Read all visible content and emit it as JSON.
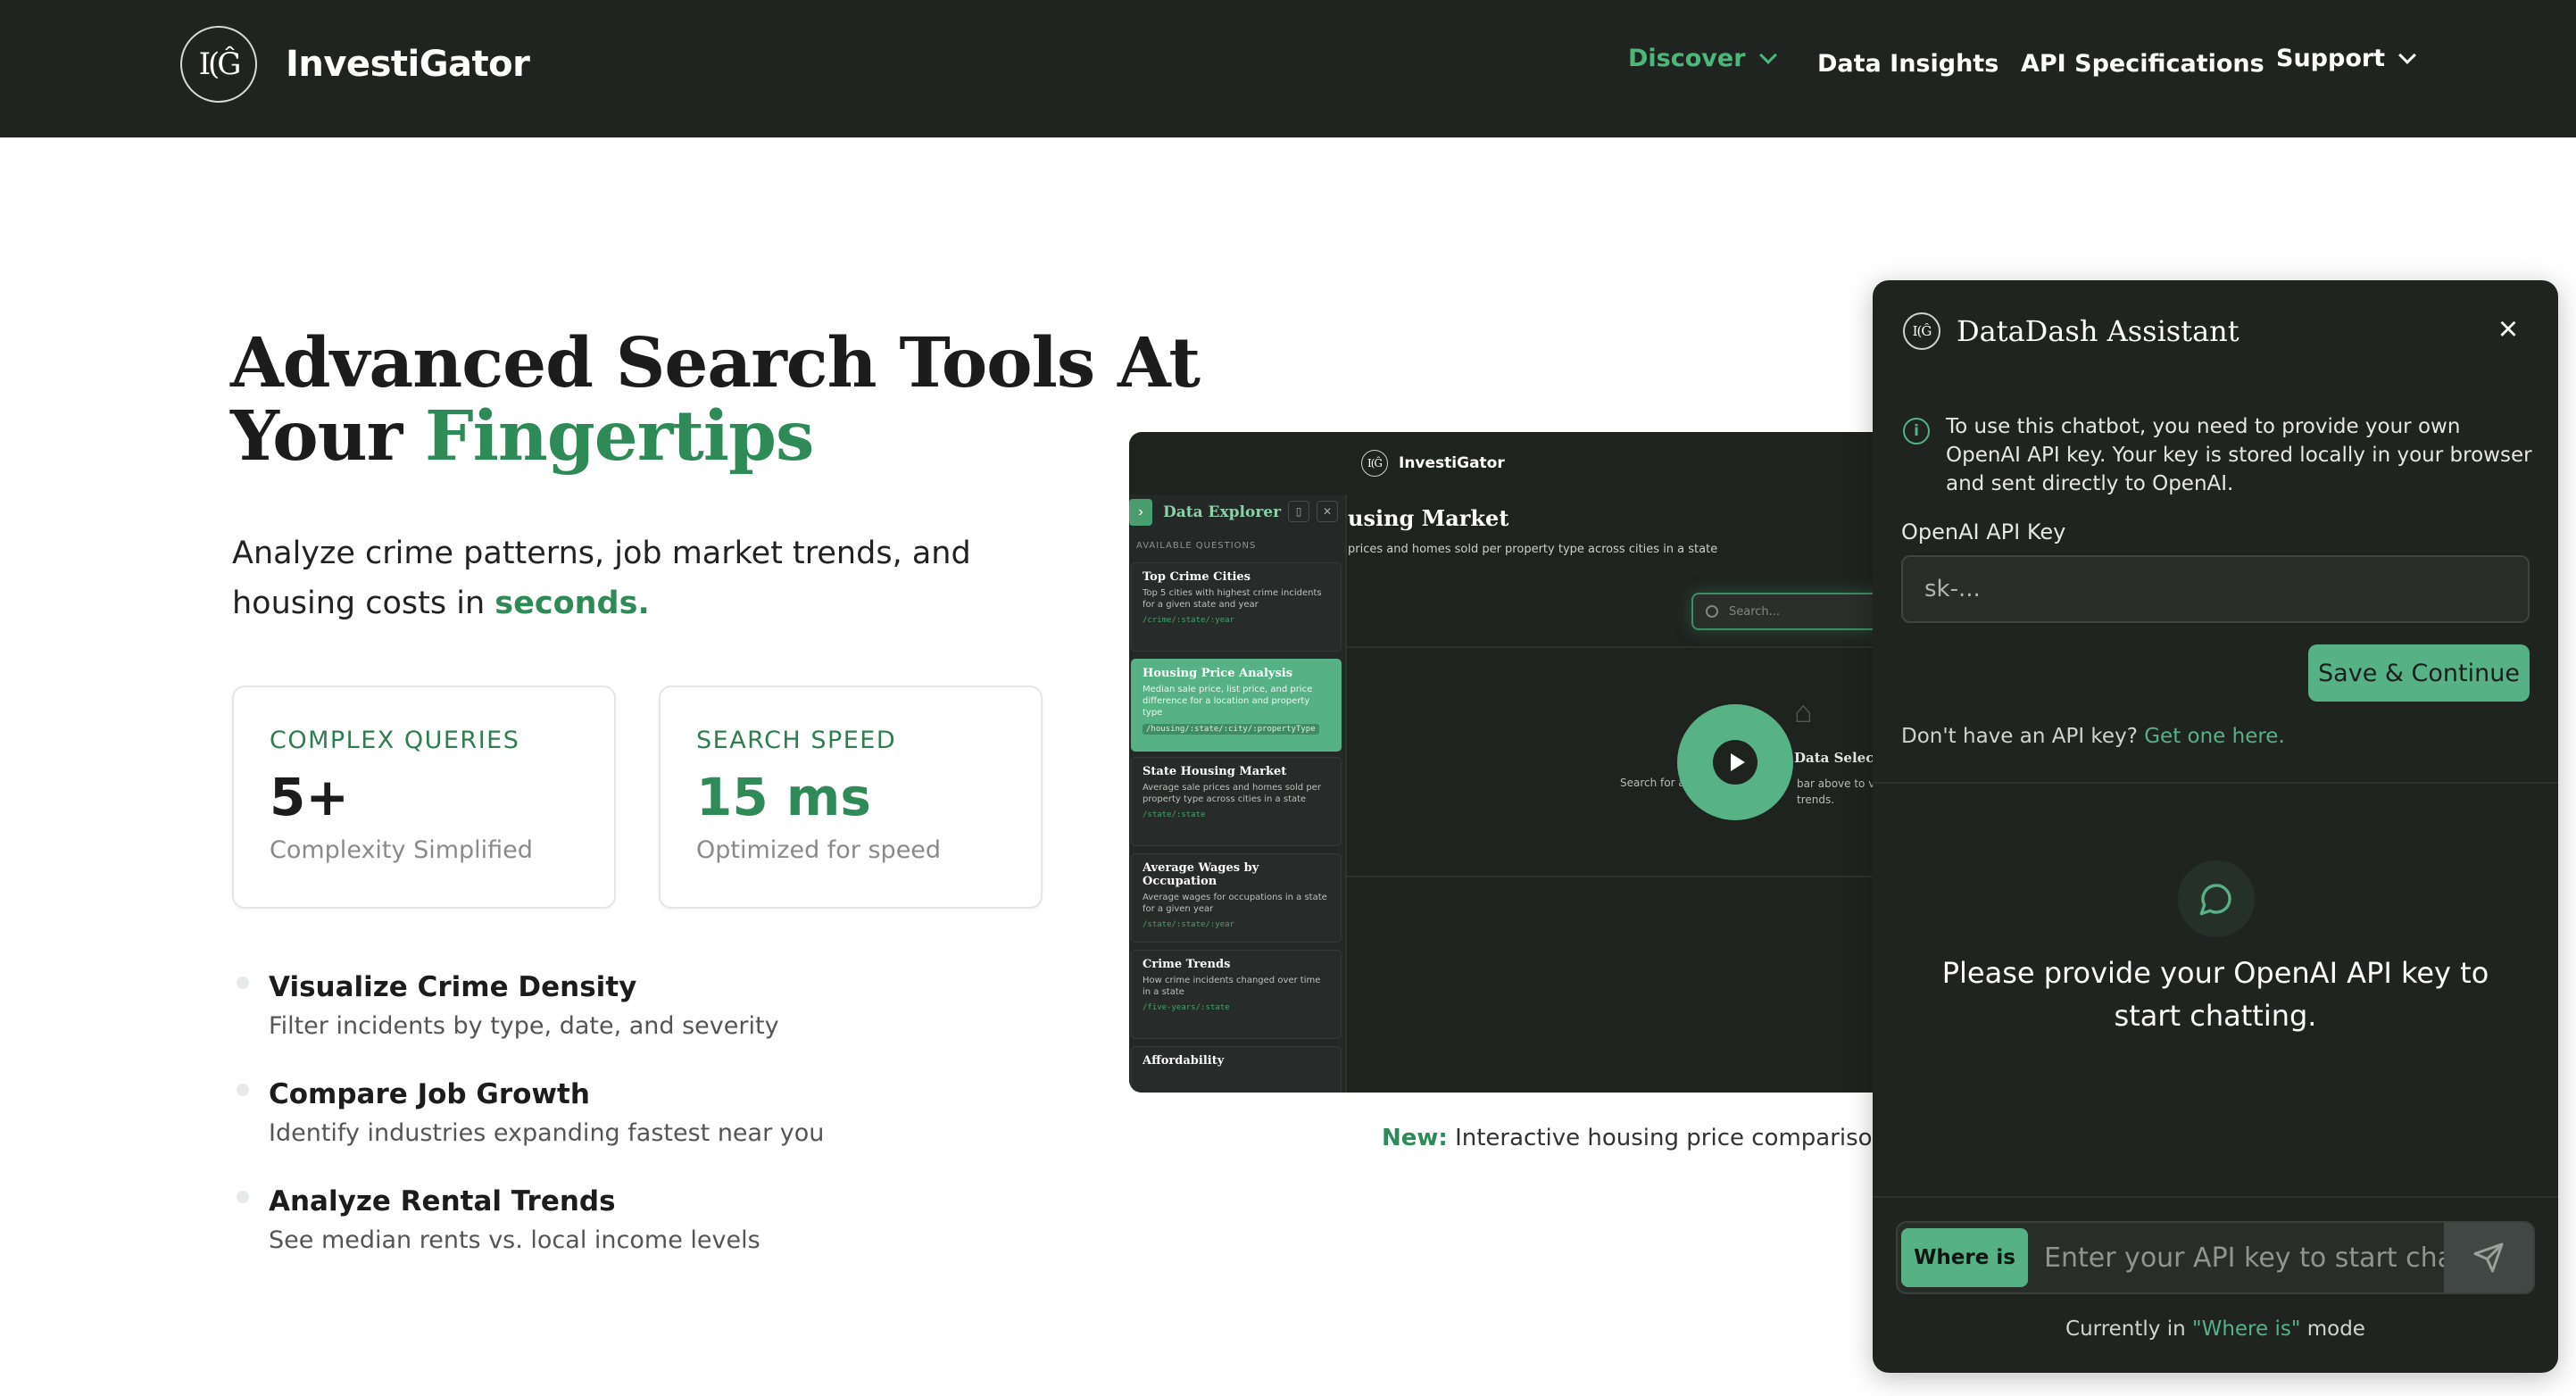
{
  "colors": {
    "nav_bg": "#202421",
    "accent": "#2e8b57",
    "accent_light": "#56b184",
    "panel_bg": "#202421"
  },
  "nav": {
    "logo_text": "I(Ĝ",
    "brand": "InvestiGator",
    "links": [
      {
        "label": "Discover",
        "has_dropdown": true,
        "active": true
      },
      {
        "label": "Data Insights",
        "has_dropdown": false
      },
      {
        "label": "API Specifications",
        "has_dropdown": false
      },
      {
        "label": "Support",
        "has_dropdown": true
      }
    ]
  },
  "hero": {
    "title_line1": "Advanced Search Tools At",
    "title_line2_plain": "Your ",
    "title_line2_accent": "Fingertips",
    "subtitle_plain": "Analyze crime patterns, job market trends, and housing costs in ",
    "subtitle_accent": "seconds."
  },
  "stats": [
    {
      "label": "COMPLEX QUERIES",
      "value": "5+",
      "caption": "Complexity Simplified"
    },
    {
      "label": "SEARCH SPEED",
      "value": "15 ms",
      "caption": "Optimized for speed"
    }
  ],
  "features": [
    {
      "title": "Visualize Crime Density",
      "desc": "Filter incidents by type, date, and severity"
    },
    {
      "title": "Compare Job Growth",
      "desc": "Identify industries expanding fastest near you"
    },
    {
      "title": "Analyze Rental Trends",
      "desc": "See median rents vs. local income levels"
    }
  ],
  "preview": {
    "brand": "InvestiGator",
    "sidebar_title": "Data Explorer",
    "available": "AVAILABLE QUESTIONS",
    "cards": [
      {
        "title": "Top Crime Cities",
        "desc": "Top 5 cities with highest crime incidents for a given state and year",
        "path": "/crime/:state/:year"
      },
      {
        "title": "Housing Price Analysis",
        "desc": "Median sale price, list price, and price difference for a location and property type",
        "path": "/housing/:state/:city/:propertyType"
      },
      {
        "title": "State Housing Market",
        "desc": "Average sale prices and homes sold per property type across cities in a state",
        "path": "/state/:state"
      },
      {
        "title": "Average Wages by Occupation",
        "desc": "Average wages for occupations in a state for a given year",
        "path": "/state/:state/:year"
      },
      {
        "title": "Crime Trends",
        "desc": "How crime incidents changed over time in a state",
        "path": "/five-years/:state"
      },
      {
        "title": "Affordability",
        "desc": "",
        "path": ""
      }
    ],
    "main_title": "using Market",
    "main_sub": "prices and homes sold per property type across cities in a state",
    "search_placeholder": "Search...",
    "data_selected": "Data Selecte",
    "search_for": "Search for a",
    "bar_text_1": "bar above to vi",
    "bar_text_2": "trends."
  },
  "caption": {
    "new": "New:",
    "text": " Interactive housing price comparisons c"
  },
  "chat": {
    "logo_text": "I(Ĝ",
    "title": "DataDash Assistant",
    "info": "To use this chatbot, you need to provide your own OpenAI API key. Your key is stored locally in your browser and sent directly to OpenAI.",
    "key_label": "OpenAI API Key",
    "key_placeholder": "sk-...",
    "save_label": "Save & Continue",
    "no_key_text": "Don't have an API key? ",
    "no_key_link": "Get one here.",
    "empty_text": "Please provide your OpenAI API key to start chatting.",
    "mode_label": "Where is",
    "input_placeholder": "Enter your API key to start chatting",
    "mode_note_prefix": "Currently in ",
    "mode_note_mode": "\"Where is\"",
    "mode_note_suffix": " mode"
  }
}
